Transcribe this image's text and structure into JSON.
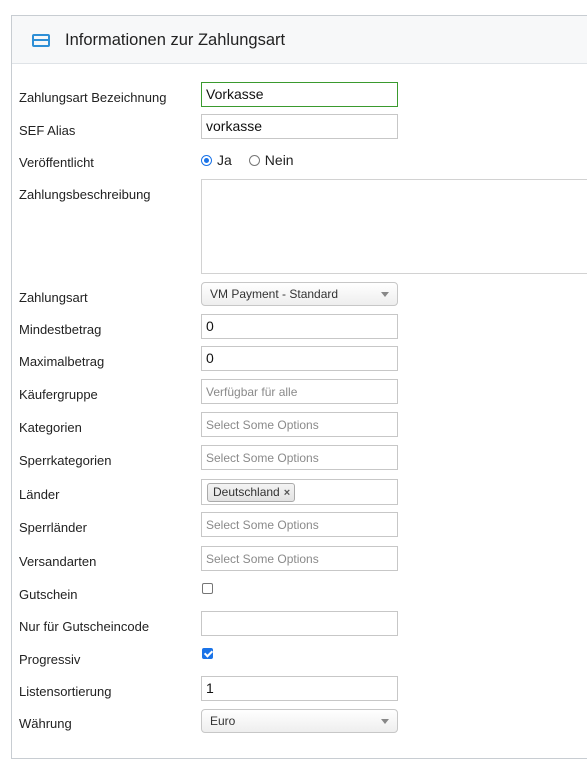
{
  "panel": {
    "title": "Informationen zur Zahlungsart",
    "icon": "credit-card-icon",
    "accent": "#2e8fd6"
  },
  "form": {
    "payment_name": {
      "label": "Zahlungsart Bezeichnung",
      "value": "Vorkasse"
    },
    "sef_alias": {
      "label": "SEF Alias",
      "value": "vorkasse"
    },
    "published": {
      "label": "Veröffentlicht",
      "options": [
        "Ja",
        "Nein"
      ],
      "selected": "Ja"
    },
    "description": {
      "label": "Zahlungsbeschreibung",
      "value": ""
    },
    "payment_method": {
      "label": "Zahlungsart",
      "value": "VM Payment - Standard"
    },
    "min_amount": {
      "label": "Mindestbetrag",
      "value": "0"
    },
    "max_amount": {
      "label": "Maximalbetrag",
      "value": "0"
    },
    "shopper_group": {
      "label": "Käufergruppe",
      "placeholder": "Verfügbar für alle"
    },
    "categories": {
      "label": "Kategorien",
      "placeholder": "Select Some Options"
    },
    "blocked_categories": {
      "label": "Sperrkategorien",
      "placeholder": "Select Some Options"
    },
    "countries": {
      "label": "Länder",
      "selected": [
        "Deutschland"
      ],
      "remove_glyph": "×"
    },
    "blocked_countries": {
      "label": "Sperrländer",
      "placeholder": "Select Some Options"
    },
    "shipment_methods": {
      "label": "Versandarten",
      "placeholder": "Select Some Options"
    },
    "coupon": {
      "label": "Gutschein",
      "checked": false
    },
    "coupon_code_only": {
      "label": "Nur für Gutscheincode",
      "value": ""
    },
    "progressive": {
      "label": "Progressiv",
      "checked": true
    },
    "ordering": {
      "label": "Listensortierung",
      "value": "1"
    },
    "currency": {
      "label": "Währung",
      "value": "Euro"
    }
  }
}
